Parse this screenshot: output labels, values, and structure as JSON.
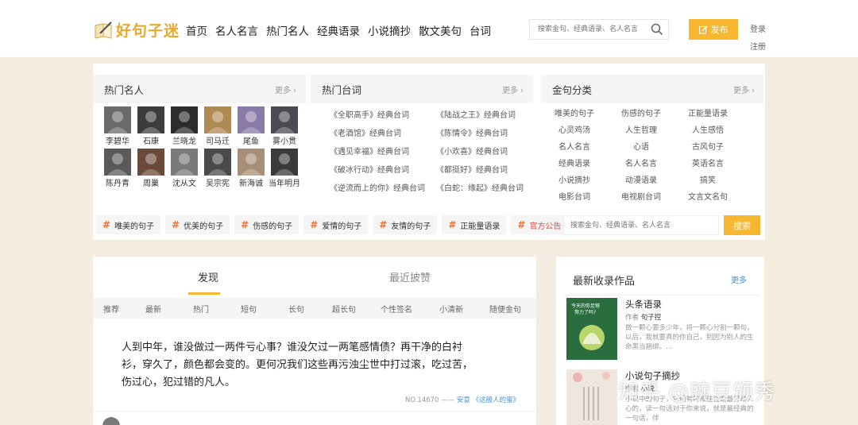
{
  "logo": {
    "text": "好句子迷"
  },
  "nav": [
    "首页",
    "名人名言",
    "热门名人",
    "经典语录",
    "小说摘抄",
    "散文美句",
    "台词"
  ],
  "search": {
    "placeholder": "搜索金句、经典语录、名人名言"
  },
  "publish_label": "发布",
  "login_label": "登录",
  "register_label": "注册",
  "celebs": {
    "title": "热门名人",
    "more": "更多",
    "items": [
      {
        "name": "李碧华",
        "color": "#6a6a6a"
      },
      {
        "name": "石康",
        "color": "#3c3c3c"
      },
      {
        "name": "兰晓龙",
        "color": "#2c2c2c"
      },
      {
        "name": "司马迁",
        "color": "#b08a55"
      },
      {
        "name": "尾鱼",
        "color": "#8a7aa8"
      },
      {
        "name": "雾小贯",
        "color": "#4a4a52"
      },
      {
        "name": "陈丹青",
        "color": "#5a5a5a"
      },
      {
        "name": "周巢",
        "color": "#6b4a3a"
      },
      {
        "name": "沈从文",
        "color": "#7a7a7a"
      },
      {
        "name": "吴宗宪",
        "color": "#4a4a4a"
      },
      {
        "name": "新海诚",
        "color": "#a89078"
      },
      {
        "name": "当年明月",
        "color": "#3a3a3a"
      }
    ]
  },
  "lines": {
    "title": "热门台词",
    "more": "更多",
    "items": [
      "《全职高手》经典台词",
      "《陆战之王》经典台词",
      "《老酒馆》经典台词",
      "《陈情令》经典台词",
      "《遇见幸福》经典台词",
      "《小欢喜》经典台词",
      "《破冰行动》经典台词",
      "《都挺好》经典台词",
      "《逆流而上的你》经典台词",
      "《白蛇：缘起》经典台词"
    ]
  },
  "categories": {
    "title": "金句分类",
    "more": "更多",
    "items": [
      "唯美的句子",
      "伤感的句子",
      "正能量语录",
      "心灵鸡汤",
      "人生哲理",
      "人生感悟",
      "名人名言",
      "心语",
      "古风句子",
      "经典语录",
      "名人名言",
      "英语名言",
      "小说摘抄",
      "动漫语录",
      "搞笑",
      "电影台词",
      "电视剧台词",
      "文言文名句"
    ]
  },
  "tags": [
    "唯美的句子",
    "优美的句子",
    "伤感的句子",
    "爱情的句子",
    "友情的句子",
    "正能量语录",
    "官方公告"
  ],
  "search2": {
    "placeholder": "搜索金句、经典语录、名人名言",
    "button": "搜索"
  },
  "feed": {
    "tab_active": "发现",
    "tab_other": "最近披赞",
    "filters": [
      "推荐",
      "最新",
      "热门",
      "短句",
      "长句",
      "超长句",
      "个性签名",
      "小清新",
      "随便金句"
    ],
    "post_text": "人到中年，谁没做过一两件亏心事？谁没欠过一两笔感情债？再干净的白衬衫，穿久了，颜色都会变的。更何况我们这些再污浊尘世中打过滚，吃过苦，伤过心，犯过错的凡人。",
    "post_no": "NO.14670",
    "post_dash": "——",
    "post_author": "安意",
    "post_source": "《这般人的蜜》"
  },
  "sidebar": {
    "title": "最新收录作品",
    "more": "更多",
    "works": [
      {
        "title": "头条语录",
        "author_label": "作者",
        "author": "句子控",
        "desc": "做一颗心要多少年，将一颗心分割一颗句，以后，我就要真的你自己，别因为别人的生命黑当捆绑。…",
        "cover_text": "今天的你足够努力了吗?",
        "cover_color": "#2f7d4a"
      },
      {
        "title": "小说句子摘抄",
        "author_label": "作者",
        "author": "小说",
        "desc": "小说中的句子，它们有时候往往是最打动人心的，读一句话对于你来说，就是最经典的一句话，伴",
        "cover_text": "",
        "cover_color": "#e8ddd6"
      }
    ]
  },
  "watermark": "知乎 @豌豆颁秀"
}
